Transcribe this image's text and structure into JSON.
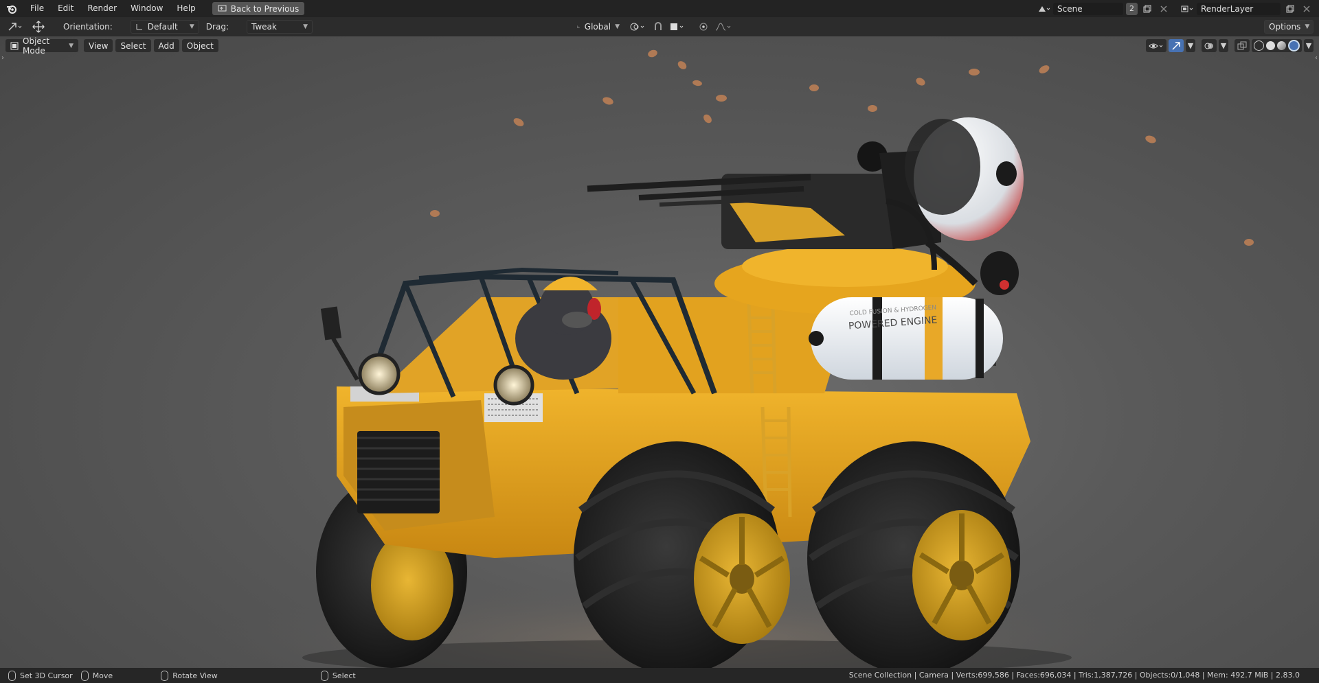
{
  "menu": {
    "items": [
      "File",
      "Edit",
      "Render",
      "Window",
      "Help"
    ],
    "back_label": "Back to Previous"
  },
  "topright": {
    "scene_name": "Scene",
    "scene_users": "2",
    "layer_name": "RenderLayer"
  },
  "toolheader": {
    "orientation_label": "Orientation:",
    "orientation_value": "Default",
    "drag_label": "Drag:",
    "drag_value": "Tweak",
    "transform_orientation": "Global",
    "options_label": "Options"
  },
  "viewport": {
    "mode": "Object Mode",
    "menu": [
      "View",
      "Select",
      "Add",
      "Object"
    ],
    "tank_text_1": "COLD FUSION & HYDROGEN",
    "tank_text_2": "POWERED ENGINE"
  },
  "status": {
    "action_1": "Set 3D Cursor",
    "action_2": "Move",
    "action_3": "Rotate View",
    "action_4": "Select",
    "stats": "Scene Collection | Camera | Verts:699,586 | Faces:696,034 | Tris:1,387,726 | Objects:0/1,048 | Mem: 492.7 MiB | 2.83.0"
  },
  "colors": {
    "vehicle_yellow": "#e2a21f",
    "header_bg": "#232323",
    "active_blue": "#4772b3"
  }
}
